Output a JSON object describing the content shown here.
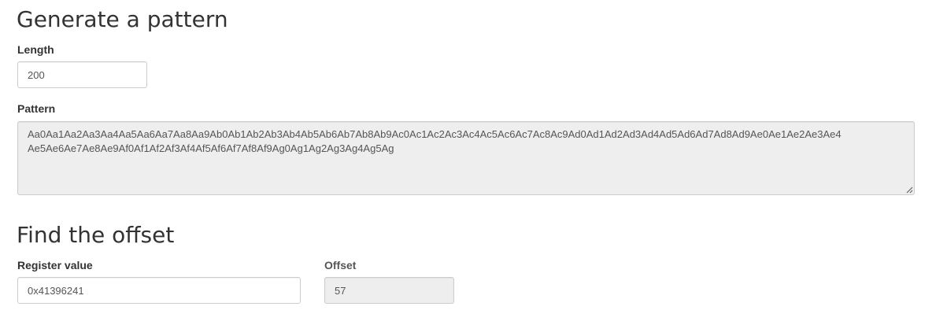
{
  "generate": {
    "heading": "Generate a pattern",
    "length_label": "Length",
    "length_value": "200",
    "pattern_label": "Pattern",
    "pattern_lines": [
      "Aa0Aa1Aa2Aa3Aa4Aa5Aa6Aa7Aa8Aa9Ab0Ab1Ab2Ab3Ab4Ab5Ab6Ab7Ab8Ab9Ac0Ac1Ac2Ac3Ac4Ac5Ac6Ac7Ac8Ac9Ad0Ad1Ad2Ad3Ad4Ad5Ad6Ad7Ad8Ad9Ae0Ae1Ae2Ae3Ae4",
      "Ae5Ae6Ae7Ae8Ae9Af0Af1Af2Af3Af4Af5Af6Af7Af8Af9Ag0Ag1Ag2Ag3Ag4Ag5Ag"
    ]
  },
  "find": {
    "heading": "Find the offset",
    "register_label": "Register value",
    "register_value": "0x41396241",
    "offset_label": "Offset",
    "offset_value": "57"
  },
  "colors": {
    "text": "#333333",
    "readonly_background": "#eeeeee",
    "border": "#cccccc"
  }
}
